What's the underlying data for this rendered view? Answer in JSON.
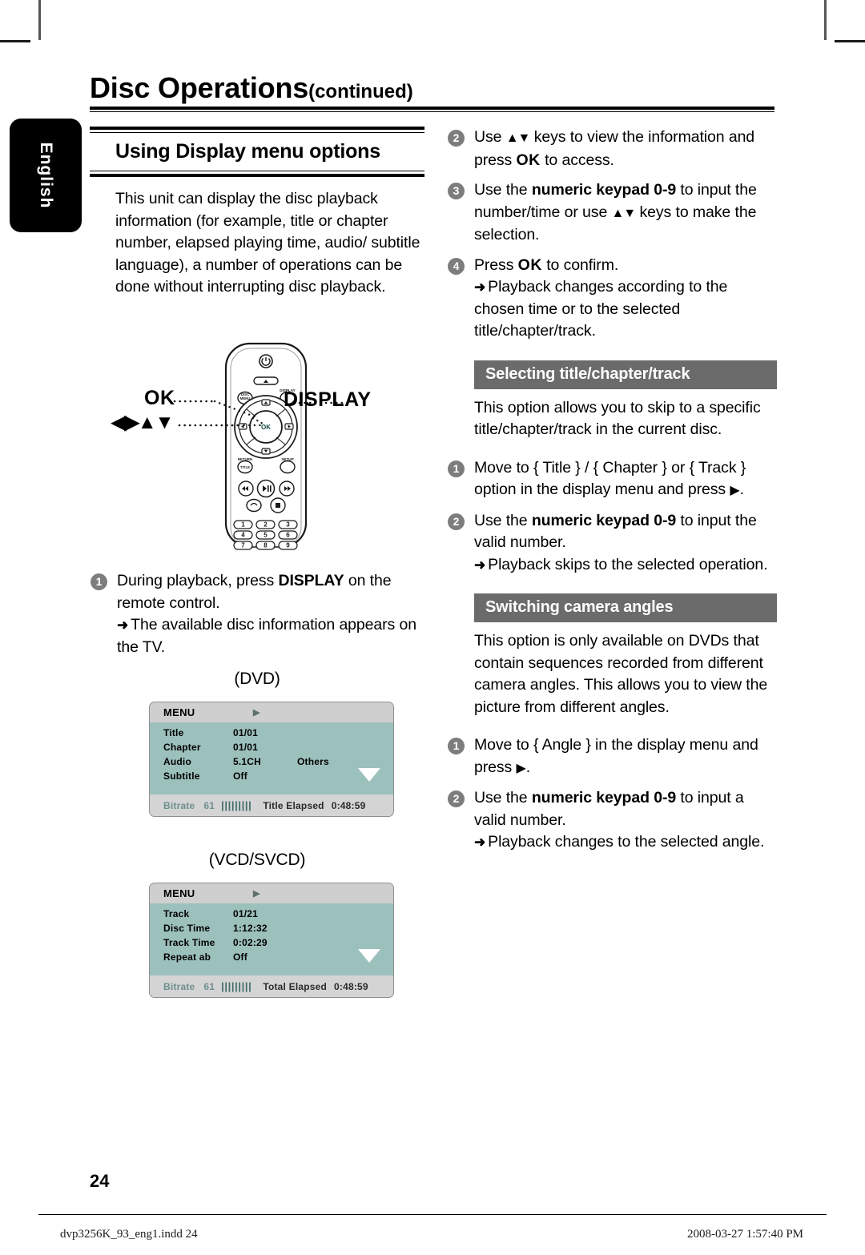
{
  "page": {
    "title_main": "Disc Operations",
    "title_continued": "(continued)",
    "language_tab": "English",
    "page_number": "24"
  },
  "left_column": {
    "section_heading": "Using Display menu options",
    "intro_paragraph": "This unit can display the disc playback information (for example, title or chapter number, elapsed playing time, audio/ subtitle language), a number of operations can be done without interrupting disc playback.",
    "remote": {
      "callout_ok": "OK",
      "callout_nav": "◀▶▲▼",
      "callout_display": "DISPLAY",
      "keypad": [
        "1",
        "2",
        "3",
        "4",
        "5",
        "6",
        "7",
        "8",
        "9"
      ],
      "button_labels": [
        "DISC MENU",
        "DISPLAY",
        "RETURN/TITLE",
        "SETUP"
      ]
    },
    "step1": {
      "number": "1",
      "text_a": "During playback, press ",
      "text_bold": "DISPLAY",
      "text_b": " on the remote control.",
      "result": "The available disc information appears on the TV."
    },
    "dvd_caption": "(DVD)",
    "vcd_caption": "(VCD/SVCD)"
  },
  "osd_dvd": {
    "title": "MENU",
    "caret": "▶",
    "rows": [
      {
        "key": "Title",
        "value": "01/01",
        "extra": ""
      },
      {
        "key": "Chapter",
        "value": "01/01",
        "extra": ""
      },
      {
        "key": "Audio",
        "value": "5.1CH",
        "extra": "Others"
      },
      {
        "key": "Subtitle",
        "value": "Off",
        "extra": ""
      }
    ],
    "footer": {
      "bitrate_label": "Bitrate",
      "bitrate_value": "61",
      "bars": "|||||||||",
      "elapsed_label": "Title Elapsed",
      "elapsed_value": "0:48:59"
    }
  },
  "osd_vcd": {
    "title": "MENU",
    "caret": "▶",
    "rows": [
      {
        "key": "Track",
        "value": "01/21",
        "extra": ""
      },
      {
        "key": "Disc  Time",
        "value": "1:12:32",
        "extra": ""
      },
      {
        "key": "Track  Time",
        "value": "0:02:29",
        "extra": ""
      },
      {
        "key": "Repeat  ab",
        "value": "Off",
        "extra": ""
      }
    ],
    "footer": {
      "bitrate_label": "Bitrate",
      "bitrate_value": "61",
      "bars": "|||||||||",
      "elapsed_label": "Total Elapsed",
      "elapsed_value": "0:48:59"
    }
  },
  "right_column": {
    "step2": {
      "number": "2",
      "part_a": "Use ",
      "keys": "▲▼",
      "part_b": " keys to view the information and press ",
      "ok": "OK",
      "part_c": " to access."
    },
    "step3": {
      "number": "3",
      "part_a": "Use the ",
      "bold": "numeric keypad 0-9",
      "part_b": " to input the number/time or use ",
      "keys": "▲▼",
      "part_c": " keys to make the selection."
    },
    "step4": {
      "number": "4",
      "part_a": "Press ",
      "ok": "OK",
      "part_b": " to confirm.",
      "result": "Playback changes according to the chosen time or to the selected title/chapter/track."
    },
    "section_title_select": "Selecting title/chapter/track",
    "select_intro": "This option allows you to skip to a specific title/chapter/track in the current disc.",
    "select_step1": {
      "number": "1",
      "part_a": "Move to { Title } / { Chapter } or { Track } option in the display menu and press ",
      "arrow": "▶",
      "part_b": "."
    },
    "select_step2": {
      "number": "2",
      "part_a": "Use the ",
      "bold": "numeric keypad 0-9",
      "part_b": " to input the valid number.",
      "result": "Playback skips to the selected operation."
    },
    "section_title_angles": "Switching camera angles",
    "angles_intro": "This option is only available on DVDs that contain sequences recorded from different camera angles. This allows you to view the picture from different angles.",
    "angles_step1": {
      "number": "1",
      "part_a": "Move to { Angle } in the display menu and press ",
      "arrow": "▶",
      "part_b": "."
    },
    "angles_step2": {
      "number": "2",
      "part_a": "Use the ",
      "bold": "numeric keypad 0-9",
      "part_b": " to input a valid number.",
      "result": "Playback changes to the selected angle."
    }
  },
  "footer": {
    "file_name": "dvp3256K_93_eng1.indd   24",
    "timestamp": "2008-03-27   1:57:40 PM"
  },
  "colors": {
    "banner_gray": "#6b6b6b",
    "osd_teal": "#9cc0bc",
    "osd_header_gray": "#cfcfcf",
    "osd_footer_gray": "#d4d4d4",
    "step_bullet_gray": "#7d7d7d"
  }
}
